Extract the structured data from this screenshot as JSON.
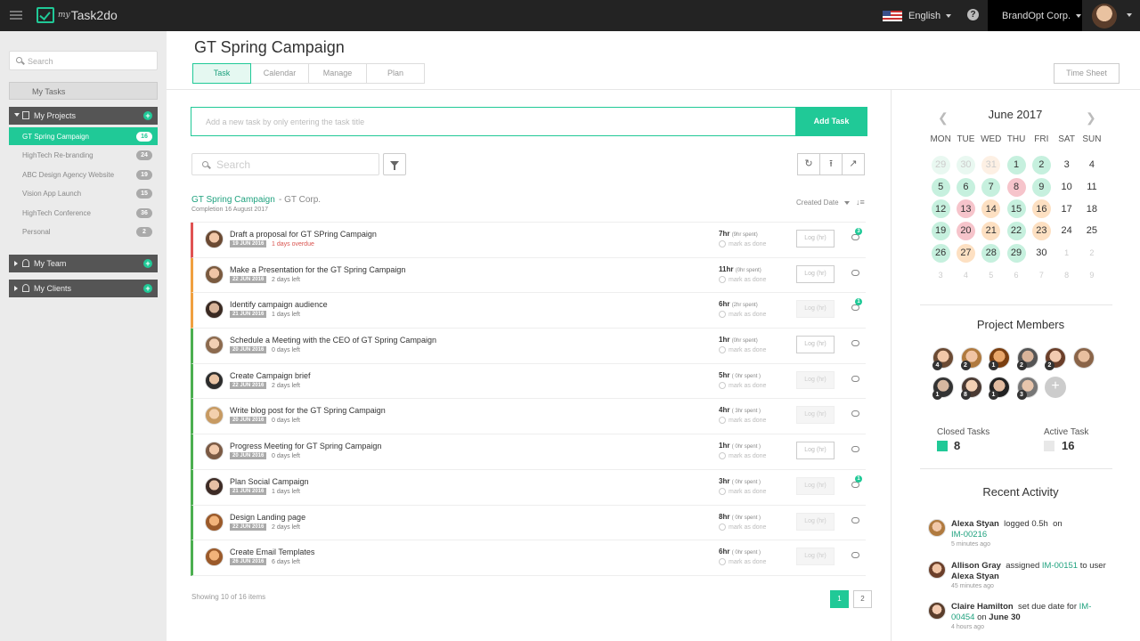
{
  "app": {
    "logo_my": "my",
    "logo_name": "Task2do",
    "language": "English",
    "company": "BrandOpt Corp."
  },
  "sidebar": {
    "search_placeholder": "Search",
    "my_tasks": "My Tasks",
    "my_projects": "My Projects",
    "projects": [
      {
        "name": "GT Spring Campaign",
        "count": "16",
        "active": true
      },
      {
        "name": "HighTech Re-branding",
        "count": "24"
      },
      {
        "name": "ABC Design Agency Website",
        "count": "19"
      },
      {
        "name": "Vision App Launch",
        "count": "15"
      },
      {
        "name": "HighTech Conference",
        "count": "36"
      },
      {
        "name": "Personal",
        "count": "2"
      }
    ],
    "my_team": "My Team",
    "my_clients": "My Clients"
  },
  "main": {
    "title": "GT Spring Campaign",
    "tabs": [
      "Task",
      "Calendar",
      "Manage",
      "Plan"
    ],
    "time_sheet": "Time Sheet",
    "add_placeholder": "Add a new task by only entering the task title",
    "add_button": "Add Task",
    "search_placeholder": "Search",
    "project_name": "GT Spring Campaign",
    "project_corp": "- GT Corp.",
    "completion": "Completion 16 August 2017",
    "sort_label": "Created Date",
    "showing": "Showing 10 of 16 items",
    "pages": [
      "1",
      "2"
    ]
  },
  "tasks": [
    {
      "title": "Draft a proposal for GT SPring Campaign",
      "date": "19 JUN 2016",
      "left": "1 days overdue",
      "overdue": true,
      "hours": "7hr",
      "spent": "(9hr spent)",
      "mark": "mark as done",
      "log": "Log (hr)",
      "color": "#e05252",
      "comments": "3",
      "log_dim": false
    },
    {
      "title": "Make a Presentation for the GT Spring Campaign",
      "date": "22 JUN 2016",
      "left": "2 days left",
      "hours": "11hr",
      "spent": "(0hr spent)",
      "mark": "mark as done",
      "log": "Log (hr)",
      "color": "#f0a040",
      "comments": "",
      "log_dim": false
    },
    {
      "title": "Identify campaign audience",
      "date": "21 JUN 2016",
      "left": "1 days left",
      "hours": "6hr",
      "spent": "(2hr spent)",
      "mark": "mark as done",
      "log": "Log (hr)",
      "color": "#f0a040",
      "comments": "1",
      "log_dim": true
    },
    {
      "title": "Schedule a Meeting with the CEO of GT Spring Campaign",
      "date": "20 JUN 2016",
      "left": "0 days left",
      "hours": "1hr",
      "spent": "(0hr spent)",
      "mark": "mark as done",
      "log": "Log (hr)",
      "color": "#4caf50",
      "comments": "",
      "log_dim": false
    },
    {
      "title": "Create Campaign brief",
      "date": "22 JUN 2016",
      "left": "2 days left",
      "hours": "5hr",
      "spent": "( 0hr spent )",
      "mark": "mark as done",
      "log": "Log (hr)",
      "color": "#4caf50",
      "comments": "",
      "log_dim": true
    },
    {
      "title": "Write blog post for the GT Spring Campaign",
      "date": "20 JUN 2016",
      "left": "0 days left",
      "hours": "4hr",
      "spent": "( 3hr spent )",
      "mark": "mark as done",
      "log": "Log (hr)",
      "color": "#4caf50",
      "comments": "",
      "log_dim": true
    },
    {
      "title": "Progress Meeting for GT Spring Campaign",
      "date": "20 JUN 2016",
      "left": "0 days left",
      "hours": "1hr",
      "spent": "( 0hr spent )",
      "mark": "mark as done",
      "log": "Log (hr)",
      "color": "#4caf50",
      "comments": "",
      "log_dim": false
    },
    {
      "title": "Plan Social Campaign",
      "date": "21 JUN 2016",
      "left": "1 days left",
      "hours": "3hr",
      "spent": "( 0hr spent )",
      "mark": "mark as done",
      "log": "Log (hr)",
      "color": "#4caf50",
      "comments": "1",
      "log_dim": true
    },
    {
      "title": "Design Landing page",
      "date": "22 JUN 2016",
      "left": "2 days left",
      "hours": "8hr",
      "spent": "( 0hr spent )",
      "mark": "mark as done",
      "log": "Log (hr)",
      "color": "#4caf50",
      "comments": "",
      "log_dim": true
    },
    {
      "title": "Create Email Templates",
      "date": "26 JUN 2016",
      "left": "6 days left",
      "hours": "6hr",
      "spent": "( 0hr spent )",
      "mark": "mark as done",
      "log": "Log (hr)",
      "color": "#4caf50",
      "comments": "",
      "log_dim": true
    }
  ],
  "calendar": {
    "title": "June 2017",
    "dows": [
      "MON",
      "TUE",
      "WED",
      "THU",
      "FRI",
      "SAT",
      "SUN"
    ],
    "days": [
      [
        "29",
        "gl"
      ],
      [
        "30",
        "gl"
      ],
      [
        "31",
        "yl"
      ],
      [
        "1",
        "g"
      ],
      [
        "2",
        "g"
      ],
      [
        "3",
        ""
      ],
      [
        "4",
        ""
      ],
      [
        "5",
        "g"
      ],
      [
        "6",
        "g"
      ],
      [
        "7",
        "g"
      ],
      [
        "8",
        "r"
      ],
      [
        "9",
        "g"
      ],
      [
        "10",
        ""
      ],
      [
        "11",
        ""
      ],
      [
        "12",
        "g"
      ],
      [
        "13",
        "r"
      ],
      [
        "14",
        "y"
      ],
      [
        "15",
        "g"
      ],
      [
        "16",
        "y"
      ],
      [
        "17",
        ""
      ],
      [
        "18",
        ""
      ],
      [
        "19",
        "g"
      ],
      [
        "20",
        "r"
      ],
      [
        "21",
        "y"
      ],
      [
        "22",
        "g"
      ],
      [
        "23",
        "y"
      ],
      [
        "24",
        ""
      ],
      [
        "25",
        ""
      ],
      [
        "26",
        "g"
      ],
      [
        "27",
        "y"
      ],
      [
        "28",
        "g"
      ],
      [
        "29",
        "g"
      ],
      [
        "30",
        ""
      ],
      [
        "1",
        "o"
      ],
      [
        "2",
        "o"
      ],
      [
        "3",
        "o"
      ],
      [
        "4",
        "o"
      ],
      [
        "5",
        "o"
      ],
      [
        "6",
        "o"
      ],
      [
        "7",
        "o"
      ],
      [
        "8",
        "o"
      ],
      [
        "9",
        "o"
      ]
    ]
  },
  "members": {
    "title": "Project Members",
    "badges": [
      "4",
      "2",
      "1",
      "2",
      "2",
      "",
      "1",
      "8",
      "1",
      "3"
    ],
    "closed_label": "Closed Tasks",
    "closed_value": "8",
    "active_label": "Active Task",
    "active_value": "16"
  },
  "activity": {
    "title": "Recent Activity",
    "items": [
      {
        "user": "Alexa Styan",
        "verb": "logged",
        "mid": "0.5h",
        "prep": "on",
        "link": "IM-00216",
        "tail": "",
        "tail_bold": "",
        "ago": "5 minutes ago"
      },
      {
        "user": "Allison Gray",
        "verb": "assigned",
        "mid": "",
        "prep": "",
        "link": "IM-00151",
        "tail": "to user",
        "tail_bold": "Alexa Styan",
        "ago": "45 minutes ago"
      },
      {
        "user": "Claire Hamilton",
        "verb": "set due date for",
        "mid": "",
        "prep": "",
        "link": "IM-00454",
        "tail": "on",
        "tail_bold": "June 30",
        "ago": "4 hours ago"
      }
    ]
  }
}
